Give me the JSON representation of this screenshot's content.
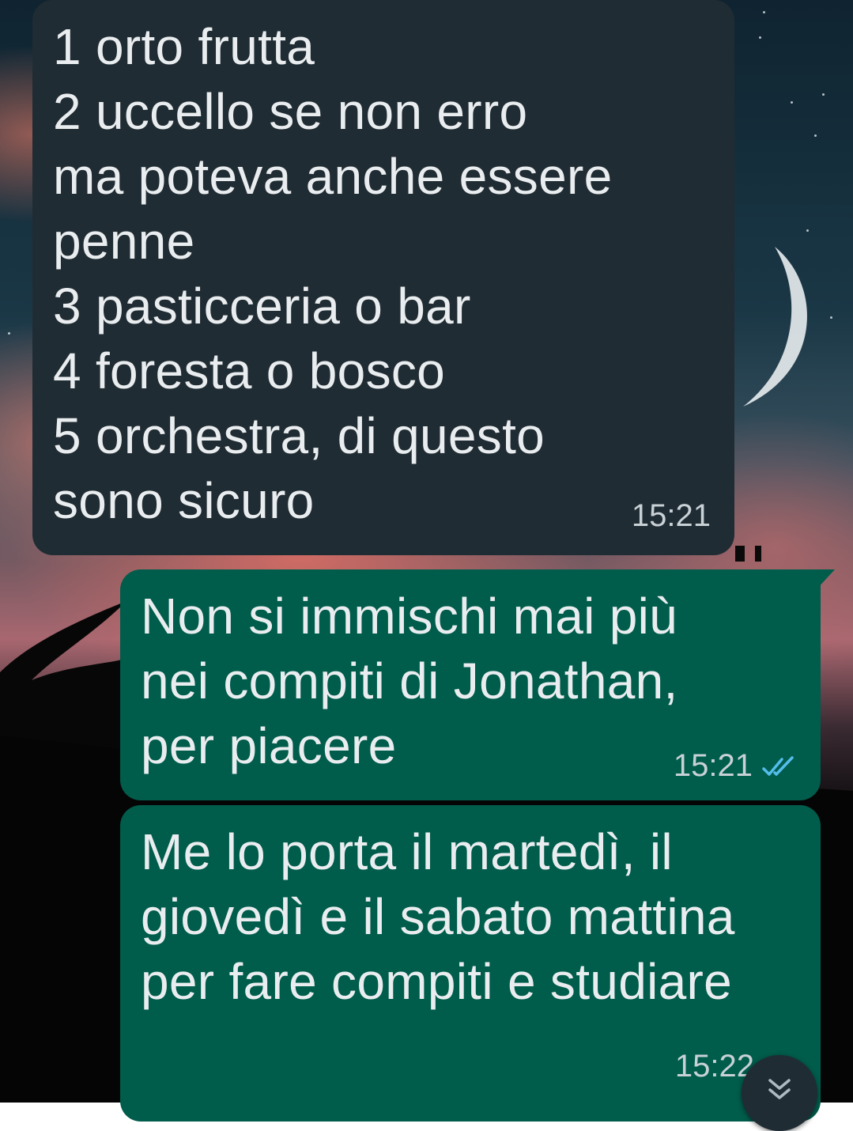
{
  "messages": [
    {
      "direction": "incoming",
      "text": "1 orto frutta\n2 uccello se non erro\nma poteva anche essere\npenne\n3 pasticceria o bar\n4 foresta o bosco\n5 orchestra, di questo\nsono sicuro",
      "time": "15:21"
    },
    {
      "direction": "outgoing",
      "text": "Non si immischi mai più\nnei compiti di Jonathan,\nper piacere",
      "time": "15:21",
      "status": "read",
      "status_icon": "double-check-icon"
    },
    {
      "direction": "outgoing",
      "text": "Me lo porta il martedì, il\ngiovedì e il sabato mattina\nper fare compiti e studiare",
      "time": "15:22"
    }
  ],
  "scroll_button_icon": "double-chevron-down-icon",
  "colors": {
    "incoming_bubble": "#202c33",
    "outgoing_bubble": "#005c4b",
    "text": "#e9edef",
    "timestamp": "#c7d1d6",
    "read_tick": "#53bdeb"
  }
}
